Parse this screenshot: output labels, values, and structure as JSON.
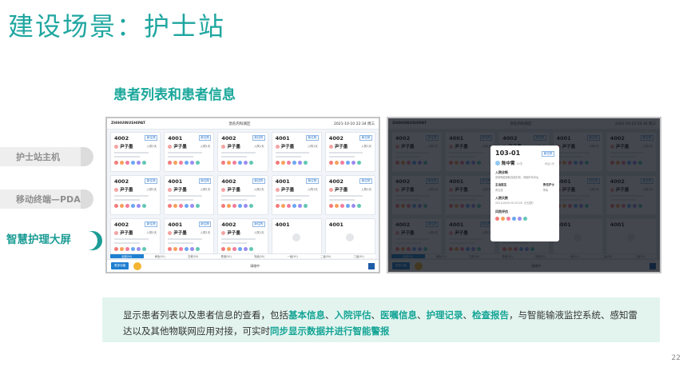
{
  "slide": {
    "title": "建设场景：护士站",
    "section_title": "患者列表和患者信息",
    "page_number": "22"
  },
  "sidebar": {
    "items": [
      {
        "label": "护士站主机",
        "active": false
      },
      {
        "label": "移动终端—PDA",
        "active": false
      },
      {
        "label": "智慧护理大屏",
        "active": true
      }
    ]
  },
  "screen": {
    "brand": "ZHIHUINUSHIPAT",
    "ward": "急危内科病区",
    "datetime": "2021-10-10 22:34 周三",
    "cards": [
      {
        "room": "4002",
        "name": "尹子墨",
        "badge": "新住院",
        "days": "入院1天"
      },
      {
        "room": "4001",
        "name": "尹子墨",
        "badge": "新住院",
        "days": "入院1天"
      },
      {
        "room": "4002",
        "name": "尹子墨",
        "badge": "新住院",
        "days": "入院1天"
      },
      {
        "room": "4001",
        "name": "尹子墨",
        "badge": "新住院",
        "days": "入院1天"
      },
      {
        "room": "4002",
        "name": "尹子墨",
        "badge": "新住院",
        "days": "入院1天"
      },
      {
        "room": "4002",
        "name": "尹子墨",
        "badge": "新住院",
        "days": "入院1天"
      },
      {
        "room": "4001",
        "name": "尹子墨",
        "badge": "新住院",
        "days": "入院1天"
      },
      {
        "room": "4002",
        "name": "尹子墨",
        "badge": "新住院",
        "days": "入院1天"
      },
      {
        "room": "4001",
        "name": "尹子墨",
        "badge": "新住院",
        "days": "入院1天"
      },
      {
        "room": "4002",
        "name": "尹子墨",
        "badge": "新住院",
        "days": "入院1天"
      },
      {
        "room": "4002",
        "name": "尹子墨",
        "badge": "新住院",
        "days": "入院1天"
      },
      {
        "room": "4001",
        "name": "尹子墨",
        "badge": "新住院",
        "days": "入院1天"
      },
      {
        "room": "4002",
        "name": "尹子墨",
        "badge": "新住院",
        "days": "入院1天"
      },
      {
        "room": "4001",
        "name": "",
        "badge": "",
        "days": "",
        "empty": true
      },
      {
        "room": "4001",
        "name": "",
        "badge": "",
        "days": "",
        "empty": true
      }
    ],
    "tabs": [
      "全部(50)",
      "病危(50)",
      "压疮(50)",
      "跌倒(50)",
      "特级(50)",
      "一级(50)",
      "二级(50)",
      "三级(50)"
    ],
    "bottom": {
      "menu_button": "更多功能",
      "status": "网络中",
      "exit": "退出"
    }
  },
  "popup": {
    "room": "103-01",
    "badge": "新住院",
    "name": "陈中霄",
    "age": "40岁",
    "status": "术后1天",
    "admit_diag_label": "入院诊断",
    "admit_diag_text": "双侧髂股静脉血栓形成，颅脑外伤术后",
    "doctor_label": "主治医生",
    "doctor": "黄玉斌",
    "nurse_label": "责任护士",
    "nurse": "李晓",
    "admit_time_label": "入院天数",
    "admit_time": "2021/10/09 00:03:28（已住院）",
    "risk_label": "风险评估"
  },
  "description": {
    "p1": "显示患者列表以及患者信息的查看，包括",
    "k1": "基本信息",
    "sep1": "、",
    "k2": "入院评估",
    "sep2": "、",
    "k3": "医嘱信息",
    "sep3": "、",
    "k4": "护理记录",
    "sep4": "、",
    "k5": "检查报告",
    "p2": "，与智能输液监控系统、感知雷",
    "p3": "达以及其他物联网应用对接，可实时",
    "k6": "同步显示数据并进行智能警报"
  },
  "colors": {
    "accent": "#1aa79b",
    "blue": "#1f7fd0"
  }
}
